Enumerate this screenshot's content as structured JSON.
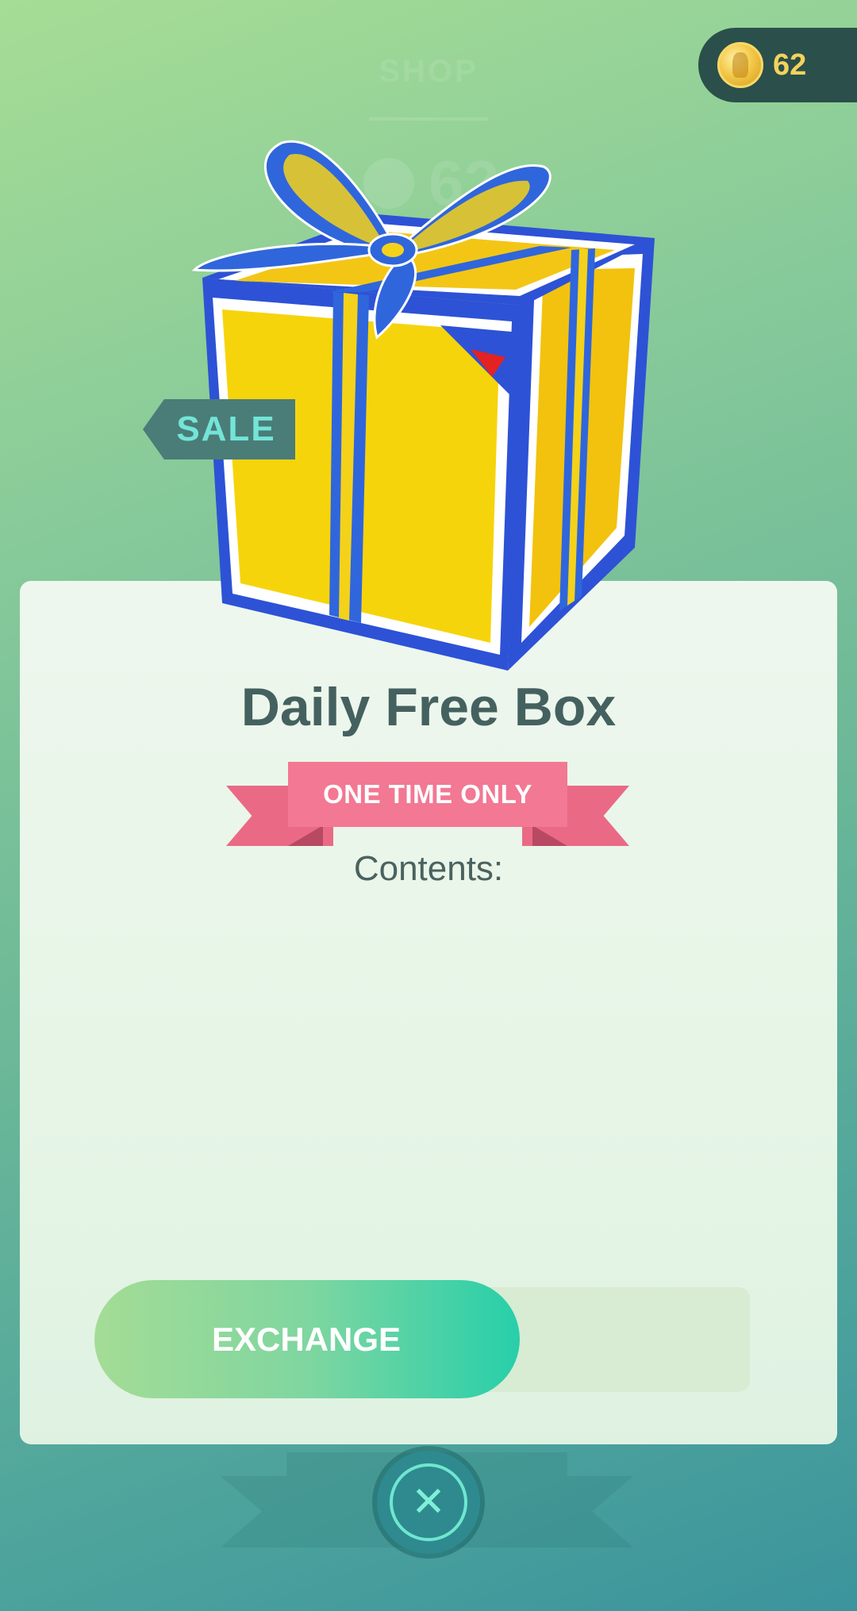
{
  "background": {
    "shop_title": "SHOP",
    "coin_total": "62"
  },
  "coins": {
    "icon": "coin-icon",
    "count": "62"
  },
  "offer": {
    "sale_tag": "SALE",
    "item_icon": "gift-box-icon",
    "title": "Daily Free Box",
    "ribbon": "ONE TIME ONLY",
    "contents_label": "Contents:"
  },
  "actions": {
    "exchange_label": "EXCHANGE",
    "close_icon": "close-icon",
    "close_glyph": "✕"
  },
  "colors": {
    "coin_gold": "#f4d25c",
    "sale_text": "#74e4d8",
    "ribbon_pink": "#f27893",
    "exchange_end": "#27cfaa",
    "title_text": "#45615f"
  }
}
